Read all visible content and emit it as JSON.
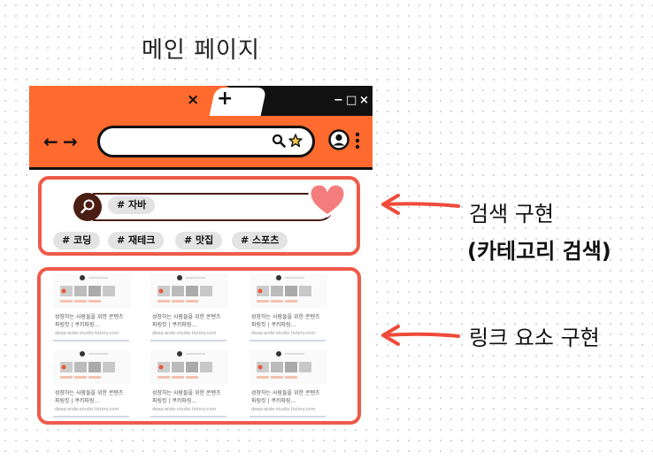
{
  "page_title": "메인 페이지",
  "browser": {
    "tab_close_glyph": "×",
    "new_tab_glyph": "+",
    "window_controls": {
      "minimize": "−",
      "maximize": "□",
      "close": "×"
    },
    "nav": {
      "back": "←",
      "forward": "→"
    },
    "icons": [
      "search-icon",
      "star-icon",
      "profile-icon",
      "kebab-menu-icon"
    ]
  },
  "search_section": {
    "current_tag": "# 자바",
    "tags": [
      "# 코딩",
      "# 재테크",
      "# 맛집",
      "# 스포츠"
    ]
  },
  "link_section": {
    "cards": [
      {
        "title": "성장하는 사람들을 위한 콘텐츠\n파링킷 | 쿠키파링...",
        "url": "deep-wide-studio.tistory.com"
      },
      {
        "title": "성장하는 사람들을 위한 콘텐츠\n파링킷 | 쿠키파링...",
        "url": "deep-wide-studio.tistory.com"
      },
      {
        "title": "성장하는 사람들을 위한 콘텐츠\n파링킷 | 쿠키파링...",
        "url": "deep-wide-studio.tistory.com"
      },
      {
        "title": "성장하는 사람들을 위한 콘텐츠\n파링킷 | 쿠키파링...",
        "url": "deep-wide-studio.tistory.com"
      },
      {
        "title": "성장하는 사람들을 위한 콘텐츠\n파링킷 | 쿠키파링...",
        "url": "deep-wide-studio.tistory.com"
      },
      {
        "title": "성장하는 사람들을 위한 콘텐츠\n파링킷 | 쿠키파링...",
        "url": "deep-wide-studio.tistory.com"
      }
    ]
  },
  "annotations": {
    "search_label_line1": "검색 구현",
    "search_label_line2": "(카테고리 검색)",
    "link_label": "링크 요소 구현"
  },
  "colors": {
    "accent": "#ff6a2e",
    "highlight": "#ef5a4a",
    "dark": "#111111",
    "heart": "#f47c7c",
    "search_brown": "#4a1e12"
  }
}
